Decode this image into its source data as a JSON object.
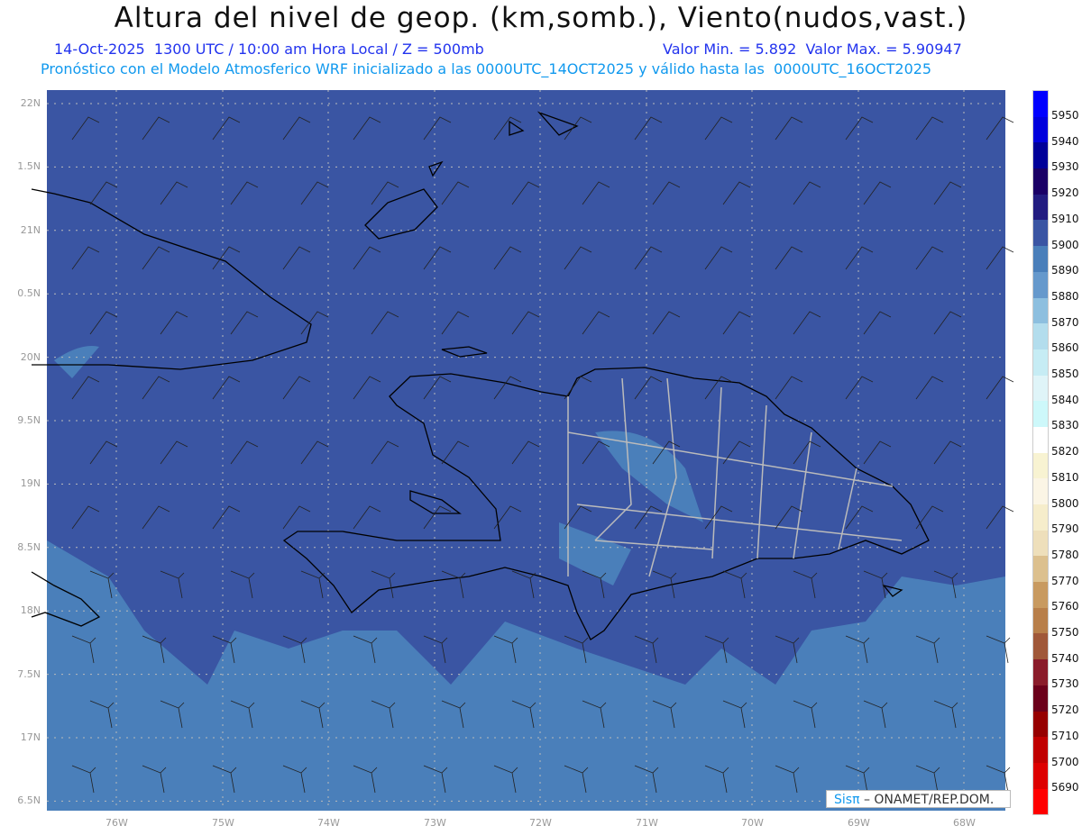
{
  "header": {
    "title": "Altura del nivel de geop. (km,somb.), Viento(nudos,vast.)",
    "line1": "14-Oct-2025  1300 UTC / 10:00 am Hora Local / Z = 500mb",
    "line1b": "Valor Min. = 5.892  Valor Max. = 5.90947",
    "line2": "Pronóstico con el Modelo Atmosferico WRF inicializado a las 0000UTC_14OCT2025 y válido hasta las  0000UTC_16OCT2025"
  },
  "axes": {
    "lon_labels": [
      "76W",
      "75W",
      "74W",
      "73W",
      "72W",
      "71W",
      "70W",
      "69W",
      "68W"
    ],
    "lat_labels": [
      "22N",
      "1.5N",
      "21N",
      "0.5N",
      "20N",
      "9.5N",
      "19N",
      "8.5N",
      "18N",
      "7.5N",
      "17N",
      "6.5N"
    ]
  },
  "colorbar": {
    "labels": [
      "5950",
      "5940",
      "5930",
      "5920",
      "5910",
      "5900",
      "5890",
      "5880",
      "5870",
      "5860",
      "5850",
      "5840",
      "5830",
      "5820",
      "5810",
      "5800",
      "5790",
      "5780",
      "5770",
      "5760",
      "5750",
      "5740",
      "5730",
      "5720",
      "5710",
      "5700",
      "5690"
    ],
    "colors": [
      "#0000ff",
      "#0000dd",
      "#000099",
      "#1a0066",
      "#221c80",
      "#3a55a3",
      "#4a7fba",
      "#6699cc",
      "#8dbfdf",
      "#b3dded",
      "#c6ecf4",
      "#dff4f8",
      "#cdf8fa",
      "#ffffff",
      "#f8f3d2",
      "#fbf5e5",
      "#f6edcb",
      "#eedfbb",
      "#dcc08e",
      "#c89a60",
      "#b87f4a",
      "#a05839",
      "#8a1c2a",
      "#6b001a",
      "#960000",
      "#c00000",
      "#dd0000",
      "#ff0000"
    ]
  },
  "credit": {
    "brand": "Sisπ",
    "text": " – ONAMET/REP.DOM."
  }
}
